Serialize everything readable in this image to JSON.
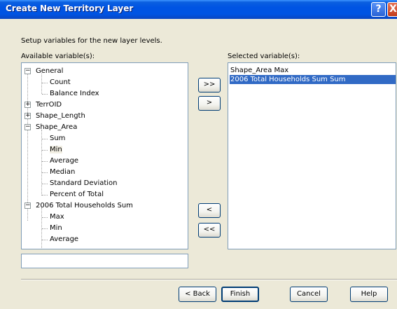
{
  "window": {
    "title": "Create New Territory Layer"
  },
  "titlebar_buttons": {
    "help": "?",
    "close": "X"
  },
  "instructions": "Setup variables for the new layer levels.",
  "available_label": "Available variable(s):",
  "selected_label": "Selected variable(s):",
  "tree": {
    "nodes": [
      {
        "label": "General",
        "expander": "−"
      },
      {
        "label": "Count"
      },
      {
        "label": "Balance Index"
      },
      {
        "label": "TerrOID",
        "expander": "+"
      },
      {
        "label": "Shape_Length",
        "expander": "+"
      },
      {
        "label": "Shape_Area",
        "expander": "−"
      },
      {
        "label": "Sum"
      },
      {
        "label": "Min"
      },
      {
        "label": "Average"
      },
      {
        "label": "Median"
      },
      {
        "label": "Standard Deviation"
      },
      {
        "label": "Percent of Total"
      },
      {
        "label": "2006 Total Households Sum",
        "expander": "−"
      },
      {
        "label": "Max"
      },
      {
        "label": "Min"
      },
      {
        "label": "Average"
      }
    ],
    "scroll_up": "▲",
    "scroll_down": "▼"
  },
  "selected": {
    "items": [
      {
        "label": "Shape_Area Max"
      },
      {
        "label": "2006 Total Households Sum Sum"
      }
    ]
  },
  "move_buttons": {
    "add_all": ">>",
    "add": ">",
    "remove": "<",
    "remove_all": "<<"
  },
  "footer": {
    "back": "< Back",
    "finish": "Finish",
    "cancel": "Cancel",
    "help": "Help"
  }
}
